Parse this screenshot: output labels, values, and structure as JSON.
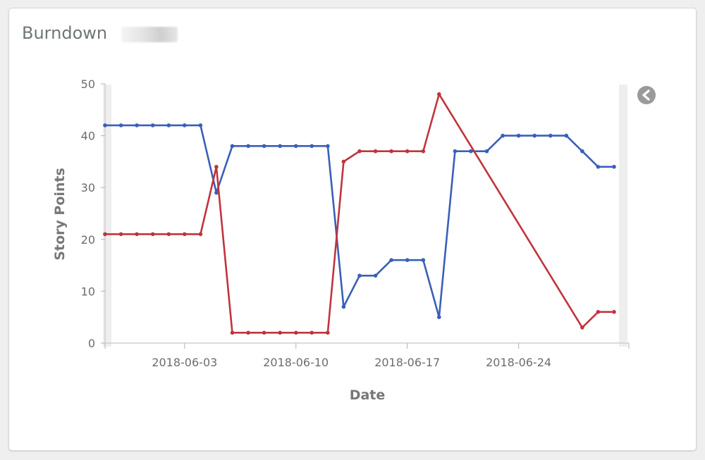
{
  "panel": {
    "title": "Burndown"
  },
  "icons": {
    "collapse": "chevron-left-circle-icon"
  },
  "colors": {
    "series_blue": "#3a5fb8",
    "series_red": "#c0343d"
  },
  "chart_data": {
    "type": "line",
    "title": "Burndown",
    "xlabel": "Date",
    "ylabel": "Story Points",
    "ylim": [
      0,
      50
    ],
    "yticks": [
      "0",
      "10",
      "20",
      "30",
      "40",
      "50"
    ],
    "xticks": [
      "2018-06-03",
      "2018-06-10",
      "2018-06-17",
      "2018-06-24"
    ],
    "x": [
      "2018-05-29",
      "2018-05-30",
      "2018-05-31",
      "2018-06-01",
      "2018-06-02",
      "2018-06-03",
      "2018-06-04",
      "2018-06-05",
      "2018-06-06",
      "2018-06-07",
      "2018-06-08",
      "2018-06-09",
      "2018-06-10",
      "2018-06-11",
      "2018-06-12",
      "2018-06-13",
      "2018-06-14",
      "2018-06-15",
      "2018-06-16",
      "2018-06-17",
      "2018-06-18",
      "2018-06-19",
      "2018-06-20",
      "2018-06-21",
      "2018-06-22",
      "2018-06-23",
      "2018-06-24",
      "2018-06-25",
      "2018-06-26",
      "2018-06-27",
      "2018-06-28",
      "2018-06-29",
      "2018-06-30"
    ],
    "series": [
      {
        "color": "#3a5fb8",
        "values": [
          42,
          42,
          42,
          42,
          42,
          42,
          42,
          29,
          38,
          38,
          38,
          38,
          38,
          38,
          38,
          7,
          13,
          13,
          16,
          16,
          16,
          5,
          37,
          37,
          37,
          40,
          40,
          40,
          40,
          40,
          37,
          34,
          34
        ]
      },
      {
        "color": "#c0343d",
        "values": [
          21,
          21,
          21,
          21,
          21,
          21,
          21,
          34,
          2,
          2,
          2,
          2,
          2,
          2,
          2,
          35,
          37,
          37,
          37,
          37,
          37,
          48,
          null,
          null,
          null,
          null,
          null,
          null,
          null,
          null,
          3,
          6,
          6
        ]
      }
    ],
    "grid": false,
    "legend": "none"
  }
}
